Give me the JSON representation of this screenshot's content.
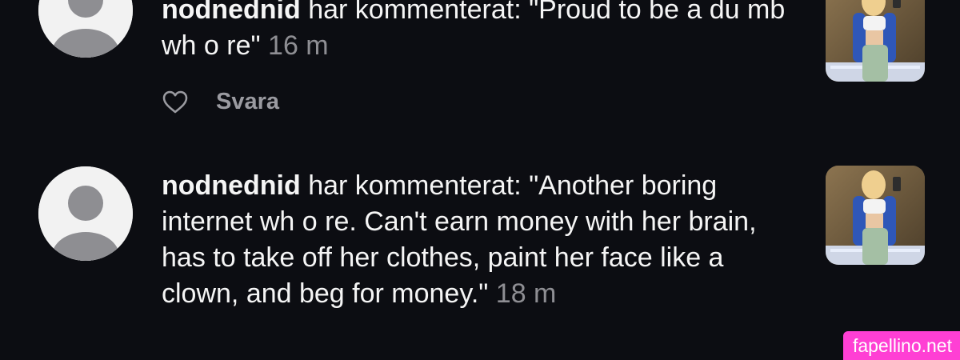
{
  "comments": [
    {
      "username": "nodnednid",
      "verb": " har kommenterat: ",
      "text": "\"Proud to be a du mb wh o re\"",
      "time": "16 m",
      "reply_label": "Svara"
    },
    {
      "username": "nodnednid",
      "verb": " har kommenterat: ",
      "text": "\"Another boring internet wh o re. Can't earn money with her brain, has to take off her clothes, paint her face like a clown, and beg for money.\"",
      "time": "18 m"
    }
  ],
  "icons": {
    "avatar": "default-avatar-icon",
    "like": "heart-outline-icon"
  },
  "colors": {
    "background": "#0c0d12",
    "text": "#f5f5f5",
    "muted": "#8e8e93",
    "watermark": "#ff3fd4"
  },
  "watermark": "fapellino.net"
}
